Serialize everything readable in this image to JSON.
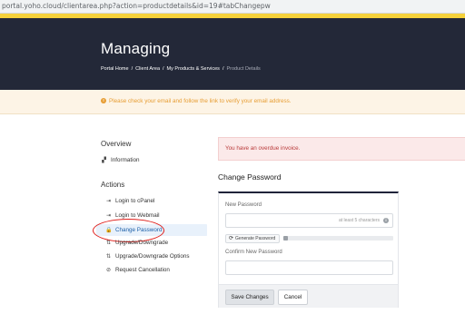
{
  "browser": {
    "url": "portal.yoho.cloud/clientarea.php?action=productdetails&id=19#tabChangepw"
  },
  "header": {
    "title": "Managing",
    "breadcrumb": [
      "Portal Home",
      "Client Area",
      "My Products & Services",
      "Product Details"
    ],
    "breadcrumb_sep": "/"
  },
  "notice": {
    "icon": "warning-icon",
    "glyph": "!",
    "text": "Please check your email and follow the link to verify your email address."
  },
  "sidebar": {
    "overview_heading": "Overview",
    "overview_items": [
      {
        "label": "Information",
        "icon": "grid-icon",
        "glyph": "▞"
      }
    ],
    "actions_heading": "Actions",
    "actions_items": [
      {
        "label": "Login to cPanel",
        "icon": "login-icon",
        "glyph": "⇥"
      },
      {
        "label": "Login to Webmail",
        "icon": "login-icon",
        "glyph": "⇥"
      },
      {
        "label": "Change Password",
        "icon": "lock-icon",
        "glyph": "🔒"
      },
      {
        "label": "Upgrade/Downgrade",
        "icon": "upgrade-icon",
        "glyph": "⇅"
      },
      {
        "label": "Upgrade/Downgrade Options",
        "icon": "upgrade-icon",
        "glyph": "⇅"
      },
      {
        "label": "Request Cancellation",
        "icon": "cancel-icon",
        "glyph": "⊘"
      }
    ]
  },
  "alert": {
    "text": "You have an overdue invoice."
  },
  "change_password": {
    "title": "Change Password",
    "new_password_label": "New Password",
    "new_password_hint": "at least 5 characters",
    "info_glyph": "i",
    "generate_label": "Generate Password",
    "generate_glyph": "⟳",
    "strength_level": 0.04,
    "confirm_label": "Confirm New Password",
    "save_label": "Save Changes",
    "cancel_label": "Cancel"
  },
  "colors": {
    "hero": "#232838",
    "accent": "#f5d13a",
    "notice": "#e79d33",
    "alert": "#b93a3a",
    "active_item": "#e8f1fb",
    "annotation": "#e0201c"
  }
}
